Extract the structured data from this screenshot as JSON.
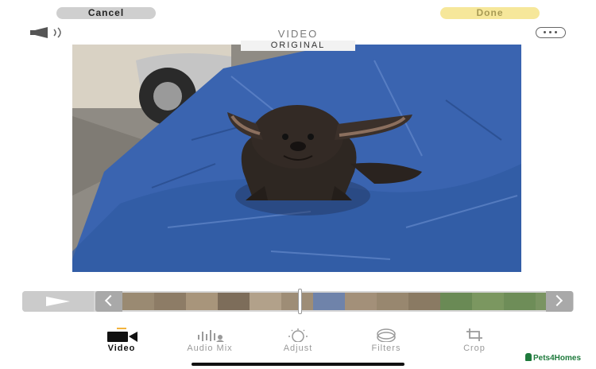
{
  "topbar": {
    "cancel_label": "Cancel",
    "done_label": "Done",
    "mode_title": "VIDEO"
  },
  "preview": {
    "tag": "ORIGINAL"
  },
  "timeline": {
    "playhead_fraction": 0.42
  },
  "tools": [
    {
      "label": "Video",
      "icon": "video-camera-icon",
      "active": true
    },
    {
      "label": "Audio Mix",
      "icon": "audio-waveform-icon",
      "active": false
    },
    {
      "label": "Adjust",
      "icon": "adjust-dial-icon",
      "active": false
    },
    {
      "label": "Filters",
      "icon": "filters-icon",
      "active": false
    },
    {
      "label": "Crop",
      "icon": "crop-icon",
      "active": false
    }
  ],
  "watermark": "Pets4Homes",
  "colors": {
    "cancel_bg": "#cfcfcf",
    "done_bg": "#f6e79a",
    "active_indicator": "#f2b33d",
    "tarp_blue": "#3a64b0"
  }
}
